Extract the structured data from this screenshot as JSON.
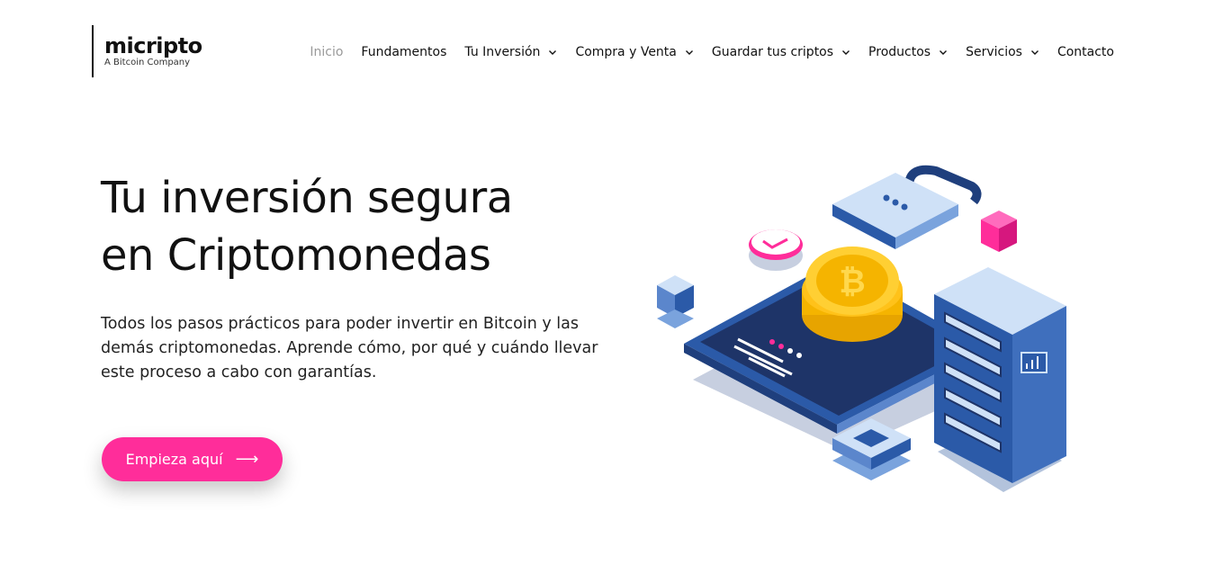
{
  "brand": {
    "name": "micripto",
    "tagline": "A Bitcoin Company"
  },
  "nav": [
    {
      "label": "Inicio",
      "active": true,
      "dropdown": false
    },
    {
      "label": "Fundamentos",
      "active": false,
      "dropdown": false
    },
    {
      "label": "Tu Inversión",
      "active": false,
      "dropdown": true
    },
    {
      "label": "Compra y Venta",
      "active": false,
      "dropdown": true
    },
    {
      "label": "Guardar tus criptos",
      "active": false,
      "dropdown": true
    },
    {
      "label": "Productos",
      "active": false,
      "dropdown": true
    },
    {
      "label": "Servicios",
      "active": false,
      "dropdown": true
    },
    {
      "label": "Contacto",
      "active": false,
      "dropdown": false
    }
  ],
  "hero": {
    "title_line1": "Tu inversión segura",
    "title_line2": "en Criptomonedas",
    "description": "Todos los pasos prácticos para poder invertir en Bitcoin y las demás criptomonedas. Aprende cómo, por qué y cuándo llevar este proceso a cabo con garantías.",
    "cta_label": "Empieza aquí",
    "cta_icon": "arrow-right-icon"
  },
  "colors": {
    "accent": "#ff2d9a",
    "text": "#111111",
    "nav_active": "#9a9a9a",
    "illustration_blue": "#1f3a6e"
  }
}
